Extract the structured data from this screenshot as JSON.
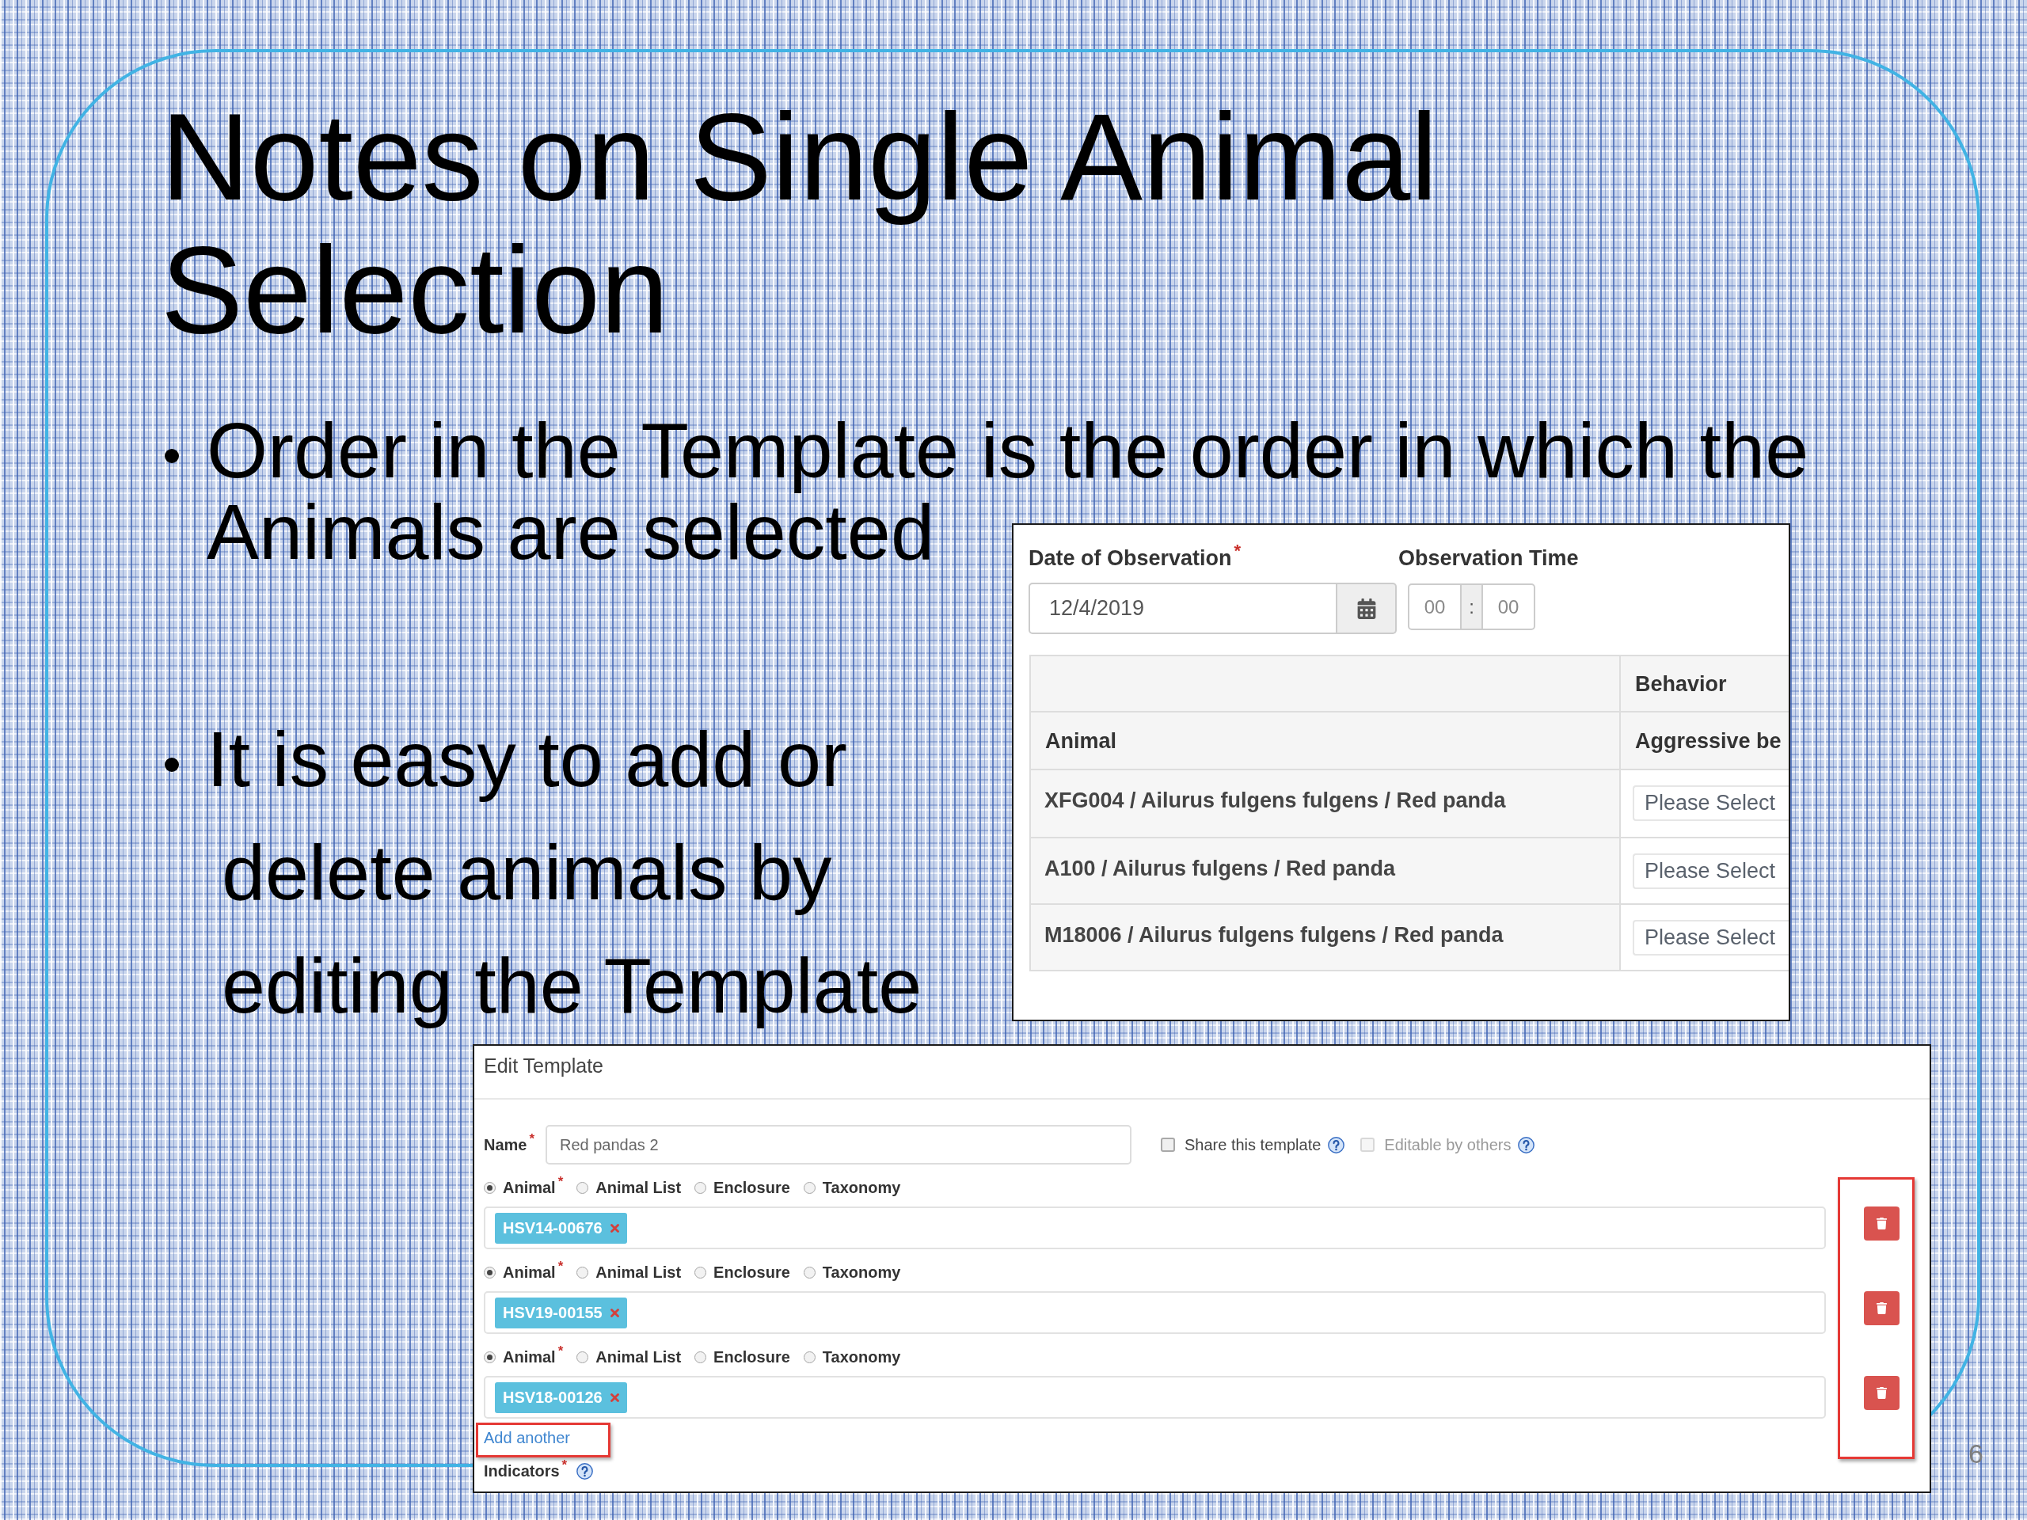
{
  "slide": {
    "title": "Notes on Single Animal Selection",
    "page_number": "6"
  },
  "bullets": [
    {
      "lines": [
        "Order in the Template is the order in which the",
        "Animals are selected"
      ]
    },
    {
      "lines": [
        "It is easy to add or",
        "delete animals by",
        "editing the Template"
      ]
    }
  ],
  "observation_form": {
    "date": {
      "label": "Date of Observation",
      "mark": "*",
      "value": "12/4/2019"
    },
    "time": {
      "label": "Observation Time",
      "hours": {
        "placeholder": "00"
      },
      "separator": ":",
      "minutes": {
        "placeholder": "00"
      }
    },
    "table": {
      "group_header": "Behavior",
      "columns": [
        "Animal",
        "Aggressive be"
      ],
      "rows": [
        {
          "animal": "XFG004 / Ailurus fulgens fulgens / Red panda",
          "behavior": {
            "placeholder": "Please Select"
          }
        },
        {
          "animal": "A100 / Ailurus fulgens / Red panda",
          "behavior": {
            "placeholder": "Please Select"
          }
        },
        {
          "animal": "M18006 / Ailurus fulgens fulgens / Red panda",
          "behavior": {
            "placeholder": "Please Select"
          }
        }
      ]
    }
  },
  "edit_template": {
    "title": "Edit Template",
    "name": {
      "label": "Name",
      "mark": "*",
      "value": "Red pandas 2"
    },
    "options": [
      {
        "label": "Share this template",
        "checked": false,
        "disabled": false,
        "help": true
      },
      {
        "label": "Editable by others",
        "checked": false,
        "disabled": true,
        "help": true
      }
    ],
    "selections": [
      {
        "types": [
          {
            "label": "Animal",
            "mark": "*",
            "selected": true
          },
          {
            "label": "Animal List",
            "selected": false
          },
          {
            "label": "Enclosure",
            "selected": false
          },
          {
            "label": "Taxonomy",
            "selected": false
          }
        ],
        "tags": [
          "HSV14-00676"
        ]
      },
      {
        "types": [
          {
            "label": "Animal",
            "mark": "*",
            "selected": true
          },
          {
            "label": "Animal List",
            "selected": false
          },
          {
            "label": "Enclosure",
            "selected": false
          },
          {
            "label": "Taxonomy",
            "selected": false
          }
        ],
        "tags": [
          "HSV19-00155"
        ]
      },
      {
        "types": [
          {
            "label": "Animal",
            "mark": "*",
            "selected": true
          },
          {
            "label": "Animal List",
            "selected": false
          },
          {
            "label": "Enclosure",
            "selected": false
          },
          {
            "label": "Taxonomy",
            "selected": false
          }
        ],
        "tags": [
          "HSV18-00126"
        ]
      }
    ],
    "delete_highlighted": true,
    "add_another": {
      "label": "Add another",
      "highlighted": true
    },
    "indicators": {
      "label": "Indicators",
      "mark": "*",
      "help": true
    }
  }
}
